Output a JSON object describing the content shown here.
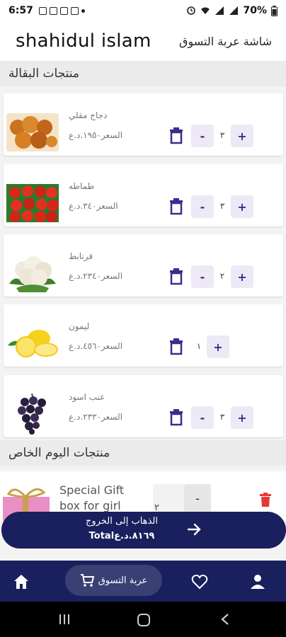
{
  "status_bar": {
    "time": "6:57",
    "battery": "70%"
  },
  "app_bar": {
    "user_name": "shahidul islam",
    "screen_title": "شاشة عربة التسوق"
  },
  "sections": {
    "grocery_title": "منتجات البقالة",
    "special_title": "منتجات اليوم الخاص"
  },
  "grocery_items": [
    {
      "name": "دجاج مقلي",
      "price": "السعر١٩٥٠.د.ع",
      "qty": "٣"
    },
    {
      "name": "طماطه",
      "price": "السعر٣٤٠.د.ع",
      "qty": "٣"
    },
    {
      "name": "قرنابط",
      "price": "السعر٢٣٤٠.د.ع",
      "qty": "٢"
    },
    {
      "name": "ليمون",
      "price": "السعر٤٥٦٠.د.ع",
      "qty": "١"
    },
    {
      "name": "عنب اسود",
      "price": "السعر٢٣٣٠.د.ع",
      "qty": "٣"
    }
  ],
  "special_items": [
    {
      "name": "Special Gift box for girl",
      "qty": "٢"
    }
  ],
  "checkout": {
    "label": "الذهاب إلى الخروج",
    "total": "Total٨١٦٩.د.ع"
  },
  "bottom_nav": {
    "cart_label": "عربة التسوق"
  },
  "controls": {
    "plus": "+",
    "minus": "-"
  },
  "icons": [
    "trash-icon",
    "arrow-right-icon",
    "home-icon",
    "cart-icon",
    "heart-icon",
    "person-icon"
  ],
  "colors": {
    "nav_bg": "#1a1f5e",
    "accent": "#3a2d8c",
    "qty_btn_bg": "#ede9f6",
    "delete_red": "#e53935"
  }
}
